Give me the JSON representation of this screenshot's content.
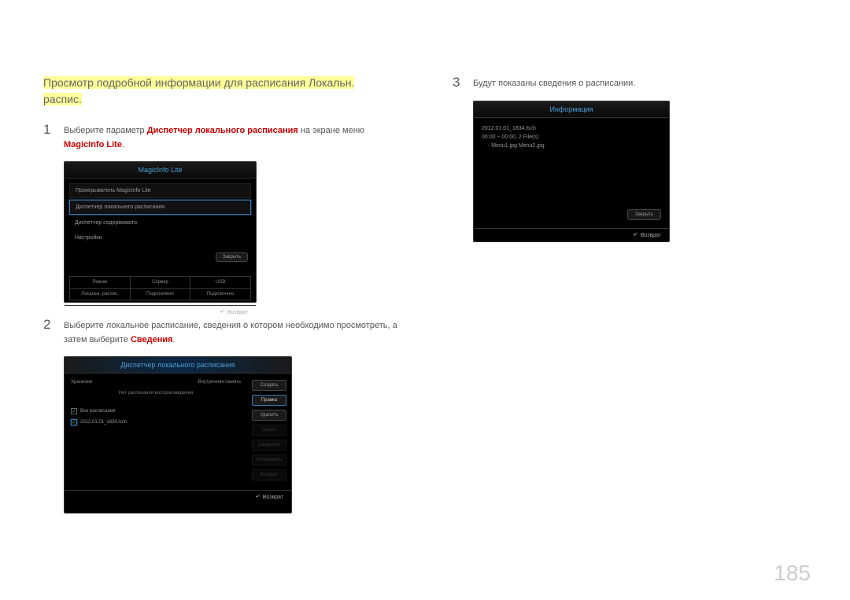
{
  "title_line1": "Просмотр подробной информации для расписания Локальн.",
  "title_line2": "распис.",
  "step1": {
    "num": "1",
    "pre": "Выберите параметр ",
    "red1": "Диспетчер локального расписания",
    "mid": " на экране меню ",
    "red2": "MagicInfo Lite",
    "post": "."
  },
  "step2": {
    "num": "2",
    "pre": "Выберите локальное расписание, сведения о котором необходимо просмотреть, а затем выберите ",
    "red": "Сведения",
    "post": "."
  },
  "step3": {
    "num": "3",
    "text": "Будут показаны сведения о расписании."
  },
  "panel1": {
    "title": "MagicInfo Lite",
    "item1": "Проигрыватель MagicInfo Lite",
    "item2": "Диспетчер локального расписания",
    "item3": "Диспетчер содержимого",
    "item4": "Настройки",
    "close": "Закрыть",
    "row1": [
      "Режим",
      "Сервер",
      "USB"
    ],
    "row2": [
      "Локальн. распис.",
      "Подключено",
      "Подключено"
    ],
    "return": "Возврат"
  },
  "panel2": {
    "title": "Диспетчер локального расписания",
    "storage": "Хранение",
    "internal": "Внутренняя память",
    "noschedule": "Нет расписания воспроизведения",
    "all": "Все расписания",
    "file": "2012.01.01_1834.lsch",
    "btn_create": "Создать",
    "btn_edit": "Правка",
    "btn_delete": "Удалить",
    "btn_run": "Запуск",
    "btn_info": "Сведения",
    "btn_copy": "Копировать",
    "btn_return2": "Возврат",
    "return": "Возврат"
  },
  "panel3": {
    "title": "Информация",
    "line1": "2012.01.01_1834.lsch",
    "line2": "00:00 ~ 00:00, 2 File(s)",
    "line3": "- Menu1.jpg Menu2.jpg",
    "close": "Закрыть",
    "return": "Возврат"
  },
  "page_num": "185",
  "return_glyph": "↶"
}
